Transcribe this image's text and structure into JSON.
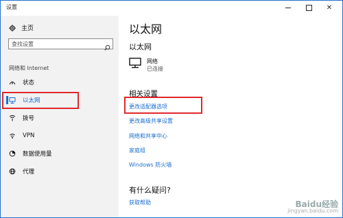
{
  "window": {
    "title": "设置",
    "minimize": "—",
    "close": "✕"
  },
  "sidebar": {
    "home_label": "主页",
    "search_placeholder": "查找设置",
    "section_header": "网络和 Internet",
    "items": [
      {
        "label": "状态",
        "icon": "status-icon"
      },
      {
        "label": "以太网",
        "icon": "ethernet-icon",
        "active": true
      },
      {
        "label": "拨号",
        "icon": "dialup-icon"
      },
      {
        "label": "VPN",
        "icon": "vpn-icon"
      },
      {
        "label": "数据使用量",
        "icon": "data-usage-icon"
      },
      {
        "label": "代理",
        "icon": "proxy-icon"
      }
    ]
  },
  "main": {
    "title": "以太网",
    "subtitle": "以太网",
    "connection": {
      "name": "网络",
      "status": "已连接"
    },
    "related_title": "相关设置",
    "links": [
      "更改适配器选项",
      "更改高级共享设置",
      "网络和共享中心",
      "家庭组",
      "Windows 防火墙"
    ],
    "question_title": "有什么疑问?",
    "help_link": "获取帮助"
  },
  "watermark": {
    "line1": "Baidu经验",
    "line2": "jingyan.baidu.com"
  },
  "colors": {
    "accent": "#1a6fd1",
    "highlight_box": "#e0262a",
    "sidebar_bg": "#f2f2f2"
  }
}
